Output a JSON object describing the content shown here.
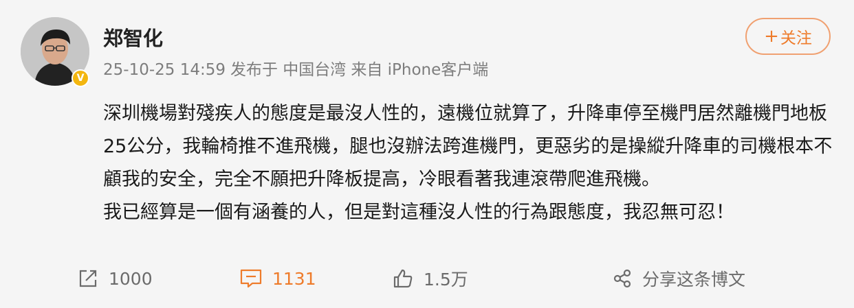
{
  "post": {
    "author": "郑智化",
    "timestamp": "25-10-25 14:59",
    "posted_at": "发布于 中国台湾",
    "source": "来自 iPhone客户端",
    "follow_label": "关注",
    "content_lines": [
      "深圳機場對殘疾人的態度是最沒人性的，遠機位就算了，升降車停至機門居然離機門地板25公分，我輪椅推不進飛機，腿也沒辦法跨進機門，更惡劣的是操縱升降車的司機根本不顧我的安全，完全不願把升降板提高，冷眼看著我連滾帶爬進飛機。",
      "我已經算是一個有涵養的人，但是對這種沒人性的行為跟態度，我忍無可忍！"
    ]
  },
  "actions": {
    "repost_count": "1000",
    "comment_count": "1131",
    "like_count": "1.5万",
    "share_label": "分享这条博文"
  },
  "colors": {
    "accent": "#ee7b2a",
    "muted": "#7d7d7d",
    "background": "#f5f5f5",
    "verified_badge": "#f3b60f"
  },
  "icons": [
    "repost-icon",
    "comment-icon",
    "like-icon",
    "share-icon",
    "verified-badge-icon"
  ]
}
